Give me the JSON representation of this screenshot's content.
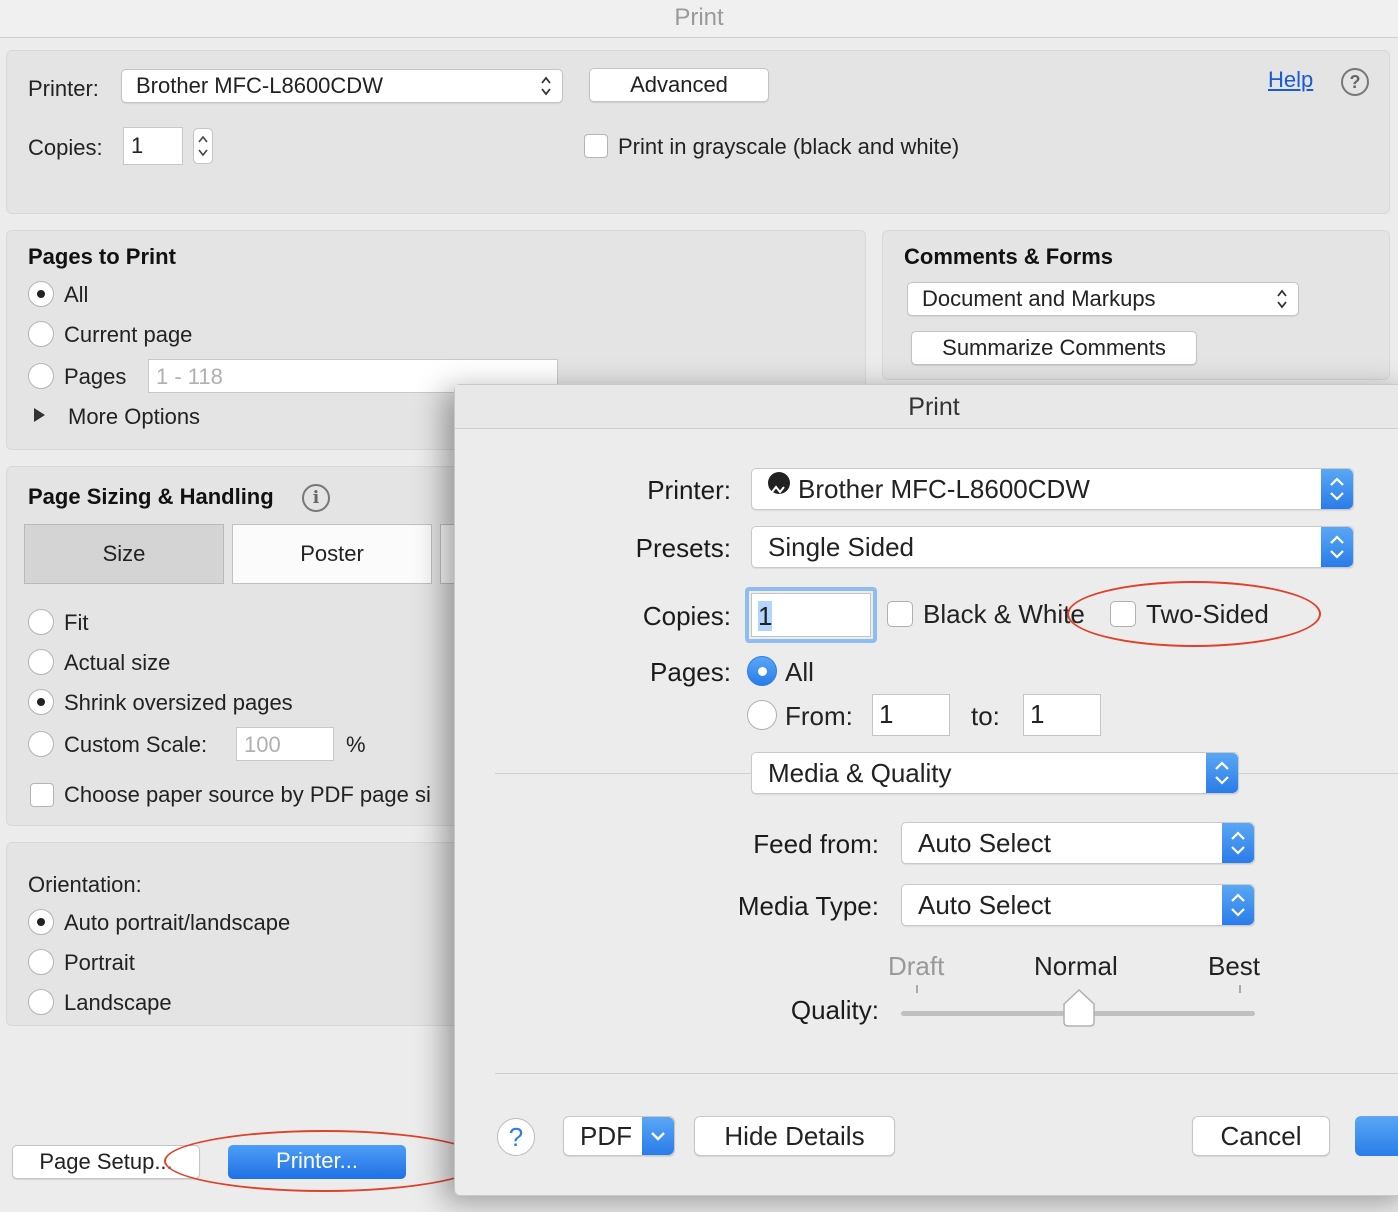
{
  "window": {
    "title": "Print"
  },
  "top": {
    "printer_label": "Printer:",
    "printer_value": "Brother MFC-L8600CDW",
    "advanced_button": "Advanced",
    "help_link": "Help",
    "help_icon": "?",
    "copies_label": "Copies:",
    "copies_value": "1",
    "grayscale_label": "Print in grayscale (black and white)"
  },
  "pages_to_print": {
    "heading": "Pages to Print",
    "all": "All",
    "current_page": "Current page",
    "pages": "Pages",
    "pages_placeholder": "1 - 118",
    "more_options": "More Options"
  },
  "comments_forms": {
    "heading": "Comments & Forms",
    "select_value": "Document and Markups",
    "summarize_button": "Summarize Comments"
  },
  "page_sizing": {
    "heading": "Page Sizing & Handling",
    "info_icon": "i",
    "tabs": [
      "Size",
      "Poster"
    ],
    "fit": "Fit",
    "actual_size": "Actual size",
    "shrink": "Shrink oversized pages",
    "custom_scale": "Custom Scale:",
    "custom_scale_value": "100",
    "percent": "%",
    "paper_source": "Choose paper source by PDF page si"
  },
  "orientation": {
    "heading": "Orientation:",
    "auto": "Auto portrait/landscape",
    "portrait": "Portrait",
    "landscape": "Landscape"
  },
  "bottom": {
    "page_setup": "Page Setup...",
    "printer_button": "Printer..."
  },
  "dialog": {
    "title": "Print",
    "printer_label": "Printer:",
    "printer_value": "Brother MFC-L8600CDW",
    "presets_label": "Presets:",
    "presets_value": "Single Sided",
    "copies_label": "Copies:",
    "copies_value": "1",
    "bw_label": "Black & White",
    "two_sided_label": "Two-Sided",
    "pages_label": "Pages:",
    "pages_all": "All",
    "pages_from": "From:",
    "from_value": "1",
    "to_label": "to:",
    "to_value": "1",
    "section_value": "Media & Quality",
    "feed_label": "Feed from:",
    "feed_value": "Auto Select",
    "media_type_label": "Media Type:",
    "media_type_value": "Auto Select",
    "quality_label": "Quality:",
    "quality_draft": "Draft",
    "quality_normal": "Normal",
    "quality_best": "Best",
    "quality_level": "Normal",
    "help_icon": "?",
    "pdf_button": "PDF",
    "hide_details": "Hide Details",
    "cancel": "Cancel"
  },
  "colors": {
    "accent": "#2a7ce9",
    "annotation": "#e0412b",
    "link": "#1a5ad4"
  }
}
